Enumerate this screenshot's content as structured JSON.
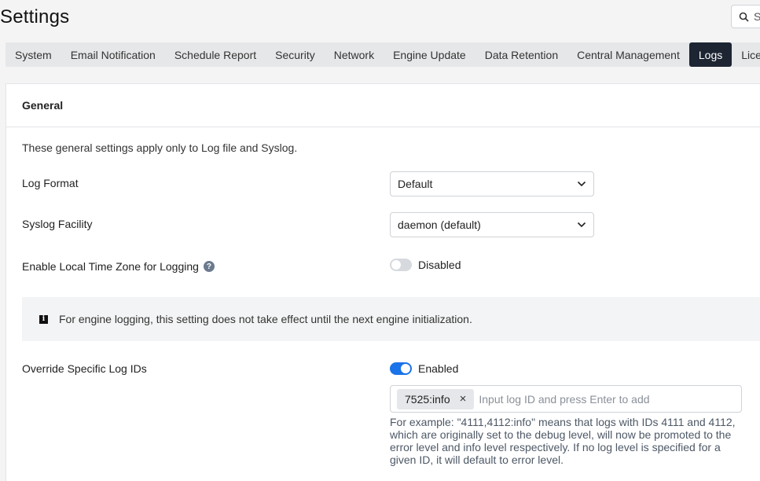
{
  "header": {
    "title": "Settings",
    "search_text": "S"
  },
  "tabs": [
    {
      "label": "System"
    },
    {
      "label": "Email Notification"
    },
    {
      "label": "Schedule Report"
    },
    {
      "label": "Security"
    },
    {
      "label": "Network"
    },
    {
      "label": "Engine Update"
    },
    {
      "label": "Data Retention"
    },
    {
      "label": "Central Management"
    },
    {
      "label": "Logs",
      "active": true
    },
    {
      "label": "Licen"
    }
  ],
  "card": {
    "title": "General",
    "intro": "These general settings apply only to Log file and Syslog."
  },
  "settings": {
    "log_format": {
      "label": "Log Format",
      "value": "Default"
    },
    "syslog_facility": {
      "label": "Syslog Facility",
      "value": "daemon (default)"
    },
    "local_time_zone": {
      "label": "Enable Local Time Zone for Logging",
      "help_icon": "question-icon",
      "state": "Disabled",
      "enabled": false
    },
    "info_message": "For engine logging, this setting does not take effect until the next engine initialization.",
    "override_log_ids": {
      "label": "Override Specific Log IDs",
      "state": "Enabled",
      "enabled": true,
      "tags": [
        "7525:info"
      ],
      "placeholder": "Input log ID and press Enter to add",
      "help_text": "For example: \"4111,4112:info\" means that logs with IDs 4111 and 4112, which are originally set to the debug level, will now be promoted to the error level and info level respectively. If no log level is specified for a given ID, it will default to error level."
    }
  },
  "colors": {
    "active_tab_bg": "#1d2533",
    "toggle_on": "#1a73e8",
    "toggle_off": "#d6d9dd"
  }
}
